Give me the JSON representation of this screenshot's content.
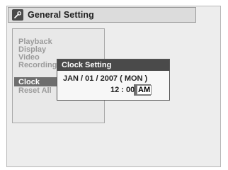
{
  "title": "General Setting",
  "menu": {
    "items": [
      {
        "label": "Playback"
      },
      {
        "label": "Display"
      },
      {
        "label": "Video"
      },
      {
        "label": "Recording"
      },
      {
        "label": "Clock"
      },
      {
        "label": "Reset All"
      }
    ],
    "selected_index": 4
  },
  "dialog": {
    "title": "Clock Setting",
    "date": "JAN / 01 / 2007 ( MON )",
    "time": "12 : 00",
    "ampm": "AM"
  },
  "icons": {
    "title_icon": "wrench-icon"
  },
  "colors": {
    "background": "#ededed",
    "title_bar": "#dcdcdc",
    "dialog_header": "#4a4a4a",
    "menu_text": "#9b9b9b",
    "selected_bg": "#6e6e6e"
  }
}
